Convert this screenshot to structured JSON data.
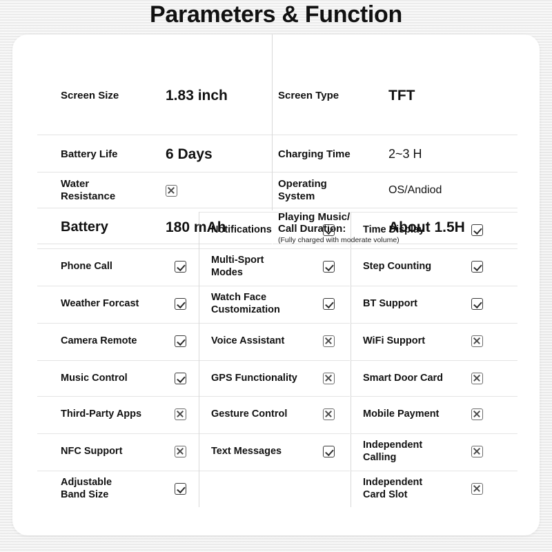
{
  "title": "Parameters & Function",
  "colors": {
    "page_background": "#efefef",
    "card_background": "#ffffff",
    "text": "#111111",
    "divider": "#d8d8d8",
    "row_divider": "#e4e4e4",
    "check_mark": "#2a2a2a",
    "cross_mark": "#4a4a4a"
  },
  "specs": {
    "rows": [
      {
        "left": {
          "label": "Screen Size",
          "value": "1.83 inch",
          "value_style": "lg"
        },
        "right": {
          "label": "Screen Type",
          "value": "TFT",
          "value_style": "lg"
        }
      },
      {
        "left": {
          "label": "Battery Life",
          "value": "6 Days",
          "value_style": "lg"
        },
        "right": {
          "label": "Charging Time",
          "value": "2~3 H",
          "value_style": "med"
        }
      },
      {
        "left": {
          "label": "Water\nResistance",
          "value": "",
          "mark": "cross"
        },
        "right": {
          "label": "Operating\nSystem",
          "value": "OS/Andiod",
          "value_style": "small"
        }
      },
      {
        "left": {
          "label": "Battery",
          "label_style": "big",
          "value": "180 mAh",
          "value_style": "lg"
        },
        "right": {
          "label": "Playing Music/\nCall Duration:",
          "subnote": "(Fully charged with moderate volume)",
          "value": "About 1.5H",
          "value_style": "lg"
        }
      }
    ]
  },
  "features": {
    "rows": [
      {
        "col1": null,
        "col2": {
          "label": "Notifications",
          "mark": "check"
        },
        "col3": {
          "label": "Time Display",
          "mark": "check"
        }
      },
      {
        "col1": {
          "label": "Phone Call",
          "mark": "check"
        },
        "col2": {
          "label": "Multi-Sport\nModes",
          "mark": "check"
        },
        "col3": {
          "label": "Step Counting",
          "mark": "check"
        }
      },
      {
        "col1": {
          "label": "Weather Forcast",
          "mark": "check"
        },
        "col2": {
          "label": "Watch Face\nCustomization",
          "mark": "check"
        },
        "col3": {
          "label": "BT Support",
          "mark": "check"
        }
      },
      {
        "col1": {
          "label": "Camera Remote",
          "mark": "check"
        },
        "col2": {
          "label": "Voice Assistant",
          "mark": "cross"
        },
        "col3": {
          "label": "WiFi Support",
          "mark": "cross"
        }
      },
      {
        "col1": {
          "label": "Music Control",
          "mark": "check"
        },
        "col2": {
          "label": "GPS Functionality",
          "mark": "cross"
        },
        "col3": {
          "label": "Smart Door Card",
          "mark": "cross"
        }
      },
      {
        "col1": {
          "label": "Third-Party Apps",
          "mark": "cross"
        },
        "col2": {
          "label": "Gesture Control",
          "mark": "cross"
        },
        "col3": {
          "label": "Mobile Payment",
          "mark": "cross"
        }
      },
      {
        "col1": {
          "label": "NFC Support",
          "mark": "cross"
        },
        "col2": {
          "label": "Text Messages",
          "mark": "check"
        },
        "col3": {
          "label": "Independent\nCalling",
          "mark": "cross"
        }
      },
      {
        "col1": {
          "label": "Adjustable\nBand Size",
          "mark": "check"
        },
        "col2": null,
        "col3": {
          "label": "Independent\nCard Slot",
          "mark": "cross"
        }
      }
    ]
  }
}
